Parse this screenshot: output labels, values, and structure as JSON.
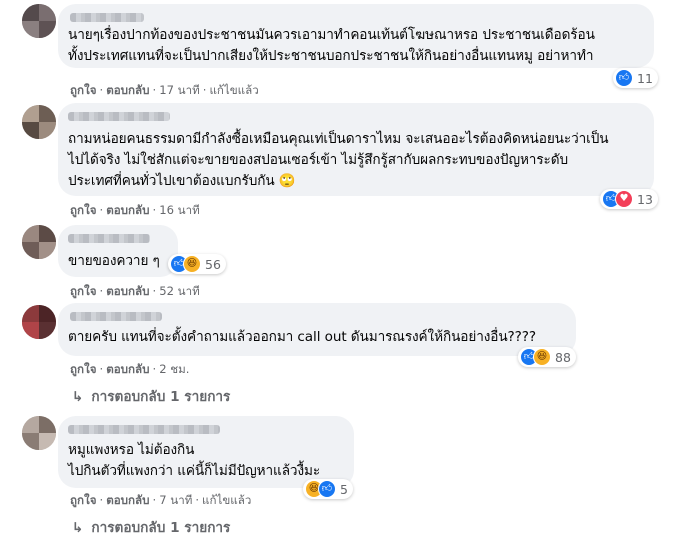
{
  "comments": [
    {
      "lines": [
        "นายๆเรื่องปากท้องของประชาชนมันควรเอามาทำคอนเท้นต์โฆษณาหรอ ประชาชนเดือดร้อน",
        "ทั้งประเทศแทนที่จะเป็นปากเสียงให้ประชาชนบอกประชาชนให้กินอย่างอื่นแทนหมู อย่าหาทำ"
      ],
      "like_label": "ถูกใจ",
      "reply_label": "ตอบกลับ",
      "time": "17 นาที",
      "edited": "แก้ไขแล้ว",
      "reaction_count": "11",
      "reaction_icons": [
        "like-icon"
      ]
    },
    {
      "lines": [
        "ถามหน่อยคนธรรมดามีกำลังซื้อเหมือนคุณเท่เป็นดาราไหม จะเสนออะไรต้องคิดหน่อยนะว่าเป็น",
        "ไปได้จริง ไม่ใช่สักแต่จะขายของสปอนเซอร์เข้า ไม่รู้สึกรู้สากับผลกระทบของปัญหาระดับ",
        "ประเทศที่คนทั่วไปเขาต้องแบกรับกัน 🙄"
      ],
      "like_label": "ถูกใจ",
      "reply_label": "ตอบกลับ",
      "time": "16 นาที",
      "reaction_count": "13",
      "reaction_icons": [
        "like-icon",
        "love-icon"
      ]
    },
    {
      "lines": [
        "ขายของควาย ๆ"
      ],
      "like_label": "ถูกใจ",
      "reply_label": "ตอบกลับ",
      "time": "52 นาที",
      "reaction_count": "56",
      "reaction_icons": [
        "like-icon",
        "haha-icon"
      ]
    },
    {
      "lines": [
        "ตายครับ แทนที่จะตั้งคำถามแล้วออกมา call out ดันมารณรงค์ให้กินอย่างอื่น????"
      ],
      "like_label": "ถูกใจ",
      "reply_label": "ตอบกลับ",
      "time": "2 ชม.",
      "reaction_count": "88",
      "reaction_icons": [
        "like-icon",
        "haha-icon"
      ],
      "replies_label": "การตอบกลับ 1 รายการ"
    },
    {
      "lines": [
        "หมูแพงหรอ ไม่ต้องกิน",
        "ไปกินตัวที่แพงกว่า แค่นี้ก็ไม่มีปัญหาแล้วงื้มะ"
      ],
      "like_label": "ถูกใจ",
      "reply_label": "ตอบกลับ",
      "time": "7 นาที",
      "edited": "แก้ไขแล้ว",
      "reaction_count": "5",
      "reaction_icons": [
        "haha-icon",
        "like-icon"
      ],
      "replies_label": "การตอบกลับ 1 รายการ"
    }
  ],
  "colors": {
    "bubble": "#f0f2f5",
    "meta": "#65676b",
    "like": "#1877f2",
    "love": "#f33e58",
    "haha": "#f7b125"
  }
}
